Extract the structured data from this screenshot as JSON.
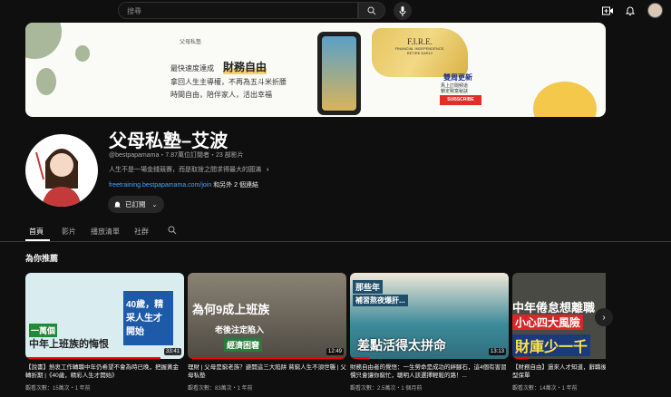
{
  "topbar": {
    "search_placeholder": "搜尋"
  },
  "banner": {
    "logo_text": "父母私塾",
    "line1": "最快速度達成",
    "highlight": "財務自由",
    "line2": "拿回人生主導權，不再為五斗米折腰",
    "line3": "時間自由，陪伴家人，活出幸福",
    "fire_title": "F.I.R.E.",
    "fire_sub1": "FINANCIAL INDEPENDENCE,",
    "fire_sub2": "RETIRE EARLY",
    "update_title": "雙周更新",
    "update_l1": "馬上訂閱頻道",
    "update_l2": "鎖定致富秘訣",
    "subscribe": "SUBSCRIBE"
  },
  "channel": {
    "name": "父母私塾–艾波",
    "meta": "@bestpapamama・7.87萬位訂閱者・23 部影片",
    "description": "人生不是一場金錢競賽，而是取捨之間求得最大的圓滿",
    "link": "freetraining.bestpapamama.com/join",
    "more_links": "和另外 2 個連結",
    "subscribed_label": "已訂閱"
  },
  "tabs": [
    {
      "label": "首頁"
    },
    {
      "label": "影片"
    },
    {
      "label": "播放清單"
    },
    {
      "label": "社群"
    }
  ],
  "section_title": "為你推薦",
  "videos": [
    {
      "thumb_text": "一萬個",
      "thumb_text2": "中年上班族的悔恨",
      "thumb_text3": "40歲，精采人生才開始",
      "duration": "33:41",
      "title": "【說書】熱衷工作轉職中年仍希望不會為時已晚，把握黃金轉折期 |《40歲，精彩人生才開始》",
      "meta": "觀看次數：15萬次・1 年前",
      "progress": 0.85,
      "bg": "#d9ecef"
    },
    {
      "thumb_text": "為何9成上班族",
      "thumb_text2": "老後注定陷入",
      "thumb_text3": "經濟困窘",
      "duration": "12:49",
      "title": "理財 | 父母是窮老族？避開這三大陷阱 貧窮人生不須世襲 | 父母私塾",
      "meta": "觀看次數：83萬次・1 年前",
      "progress": 1,
      "bg": "#6f6a5e"
    },
    {
      "thumb_text": "那些年",
      "thumb_text2": "補習熬夜爆肝...",
      "thumb_text3": "差點活得太拼命",
      "duration": "13:13",
      "title": "財務自由者的覺悟：一生勞命是成功的絆腳石，這4個有害習慣只會讓你窮忙，聰明人該選擇輕鬆的路！...",
      "meta": "觀看次數：2.5萬次・1 個月前",
      "progress": 0.12,
      "bg": "#3d8a9a"
    },
    {
      "thumb_text": "中年倦怠想離職",
      "thumb_text2": "小心四大風險",
      "thumb_text3": "財庫少一千",
      "duration": "",
      "title": "【財務自由】過來人才知道，辭職後需要錢體會，不買投資型保單",
      "meta": "觀看次數：14萬次・1 年前",
      "progress": 0.1,
      "bg": "#4a4a44"
    }
  ]
}
